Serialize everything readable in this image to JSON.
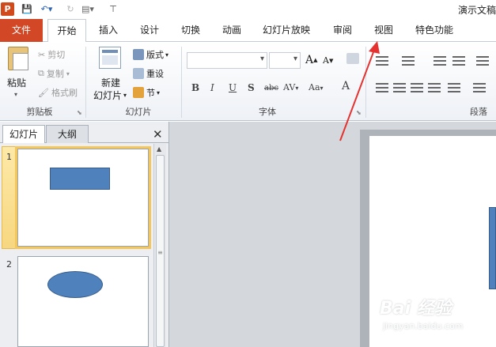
{
  "quick_access": {
    "app_icon": "P",
    "save_icon": "💾",
    "undo_icon": "↶▾",
    "redo_icon": "↻",
    "new_slide_icon": "▤▾",
    "customize_icon": "⊤"
  },
  "window": {
    "title": "演示文稿"
  },
  "tabs": [
    {
      "label": "文件"
    },
    {
      "label": "开始"
    },
    {
      "label": "插入"
    },
    {
      "label": "设计"
    },
    {
      "label": "切换"
    },
    {
      "label": "动画"
    },
    {
      "label": "幻灯片放映"
    },
    {
      "label": "审阅"
    },
    {
      "label": "视图"
    },
    {
      "label": "特色功能"
    }
  ],
  "ribbon": {
    "clipboard": {
      "paste": "粘贴",
      "cut": "剪切",
      "copy": "复制",
      "format_painter": "格式刷",
      "group_label": "剪贴板"
    },
    "slides": {
      "new_slide_line1": "新建",
      "new_slide_line2": "幻灯片",
      "layout": "版式",
      "reset": "重设",
      "section": "节",
      "group_label": "幻灯片"
    },
    "font": {
      "font_name": "",
      "font_size": "",
      "grow": "A",
      "shrink": "A",
      "bold": "B",
      "italic": "I",
      "underline": "U",
      "shadow": "S",
      "strike": "abc",
      "spacing": "AV",
      "case": "Aa",
      "color": "A",
      "group_label": "字体"
    },
    "paragraph": {
      "group_label": "段落"
    }
  },
  "panel": {
    "tab_slides": "幻灯片",
    "tab_outline": "大纲",
    "close": "✕",
    "slides": [
      {
        "number": "1"
      },
      {
        "number": "2"
      }
    ]
  },
  "watermark": {
    "brand": "Bai 经验",
    "url": "jingyan.baidu.com"
  },
  "colors": {
    "file_tab": "#d24726",
    "shape_fill": "#4f81bd",
    "selection": "#f3c75c",
    "arrow": "#e5312f"
  }
}
